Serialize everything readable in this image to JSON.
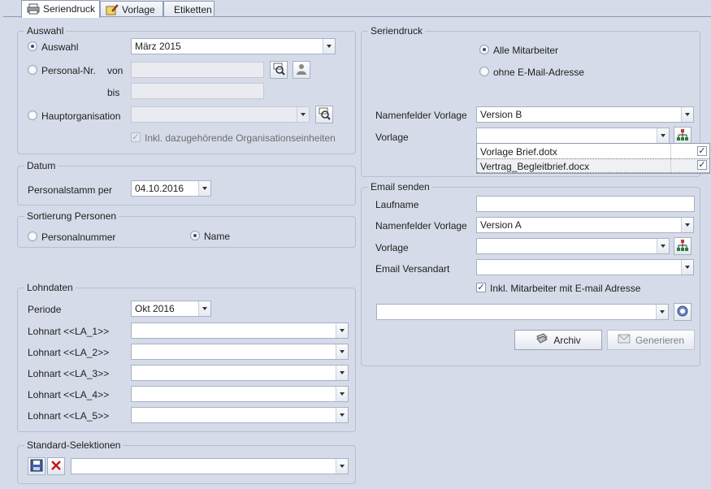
{
  "tabs": [
    {
      "label": "Seriendruck",
      "icon": "printer-icon",
      "active": true
    },
    {
      "label": "Vorlage",
      "icon": "template-edit-icon",
      "active": false
    },
    {
      "label": "Etiketten",
      "icon": "",
      "active": false
    }
  ],
  "auswahl": {
    "legend": "Auswahl",
    "radio_auswahl": "Auswahl",
    "auswahl_value": "März 2015",
    "radio_personal_nr": "Personal-Nr.",
    "von_label": "von",
    "bis_label": "bis",
    "von_value": "",
    "bis_value": "",
    "radio_hauptorganisation": "Hauptorganisation",
    "hauptorganisation_value": "",
    "inkl_org_label": "Inkl. dazugehörende Organisationseinheiten"
  },
  "datum": {
    "legend": "Datum",
    "personalstamm_label": "Personalstamm per",
    "personalstamm_value": "04.10.2016"
  },
  "sortierung": {
    "legend": "Sortierung Personen",
    "radio_personalnummer": "Personalnummer",
    "radio_name": "Name"
  },
  "lohndaten": {
    "legend": "Lohndaten",
    "periode_label": "Periode",
    "periode_value": "Okt 2016",
    "lohnarten": [
      {
        "label": "Lohnart <<LA_1>>",
        "value": ""
      },
      {
        "label": "Lohnart <<LA_2>>",
        "value": ""
      },
      {
        "label": "Lohnart <<LA_3>>",
        "value": ""
      },
      {
        "label": "Lohnart <<LA_4>>",
        "value": ""
      },
      {
        "label": "Lohnart <<LA_5>>",
        "value": ""
      }
    ]
  },
  "standard": {
    "legend": "Standard-Selektionen",
    "value": ""
  },
  "seriendruck": {
    "legend": "Seriendruck",
    "radio_alle": "Alle Mitarbeiter",
    "radio_ohne_email": "ohne E-Mail-Adresse",
    "namenfelder_label": "Namenfelder Vorlage",
    "namenfelder_value": "Version B",
    "vorlage_label": "Vorlage",
    "vorlage_value": "",
    "vorlage_options": [
      "Vorlage Brief.dotx",
      "Vertrag_Begleitbrief.docx"
    ]
  },
  "email": {
    "legend": "Email senden",
    "laufname_label": "Laufname",
    "laufname_value": "",
    "namenfelder_label": "Namenfelder Vorlage",
    "namenfelder_value": "Version A",
    "vorlage_label": "Vorlage",
    "vorlage_value": "",
    "versandart_label": "Email Versandart",
    "versandart_value": "",
    "inkl_label": "Inkl. Mitarbeiter mit E-mail Adresse",
    "extra_value": "",
    "archiv_label": "Archiv",
    "generieren_label": "Generieren"
  }
}
